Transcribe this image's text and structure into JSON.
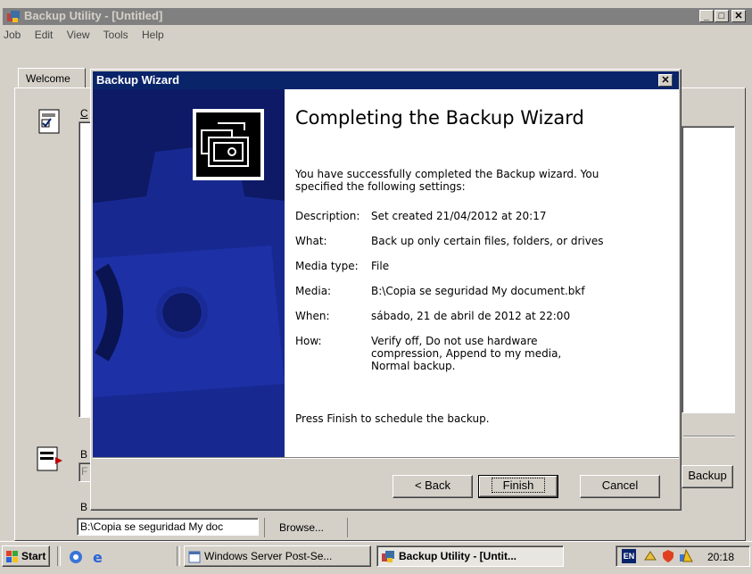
{
  "app": {
    "title": "Backup Utility - [Untitled]",
    "menu": [
      "Job",
      "Edit",
      "View",
      "Tools",
      "Help"
    ],
    "tab_welcome": "Welcome",
    "partial_label_top": "C",
    "partial_label_mid": "B",
    "partial_field": "F",
    "partial_label_bottom": "B",
    "path_value": "B:\\Copia se seguridad My doc",
    "browse_label": "Browse...",
    "start_backup_label": "Backup"
  },
  "wizard": {
    "title": "Backup Wizard",
    "heading": "Completing the Backup Wizard",
    "intro": "You have successfully completed the Backup wizard. You specified the following settings:",
    "settings": [
      {
        "label": "Description:",
        "value": "Set created 21/04/2012 at 20:17"
      },
      {
        "label": "What:",
        "value": "Back up only certain files, folders, or drives"
      },
      {
        "label": "Media type:",
        "value": "File"
      },
      {
        "label": "Media:",
        "value": "B:\\Copia se seguridad My document.bkf"
      },
      {
        "label": "When:",
        "value": "sábado, 21 de abril de 2012 at 22:00"
      },
      {
        "label": "How:",
        "value": "Verify off, Do not use hardware compression, Append to my media, Normal backup."
      }
    ],
    "finish_prompt": "Press Finish to schedule the backup.",
    "back_label": "< Back",
    "finish_label": "Finish",
    "cancel_label": "Cancel"
  },
  "taskbar": {
    "start_label": "Start",
    "task1": "Windows Server Post-Se...",
    "task2": "Backup Utility - [Untit...",
    "lang": "EN",
    "clock": "20:18"
  },
  "colors": {
    "titlebar": "#0a246a",
    "wizard_banner": "#0e1a66",
    "face": "#d4d0c8"
  }
}
